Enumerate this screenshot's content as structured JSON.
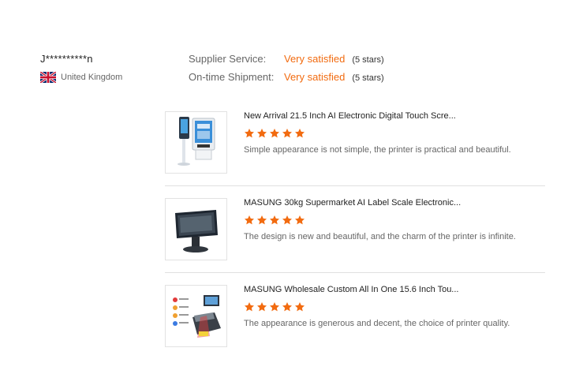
{
  "reviewer": {
    "name": "J**********n",
    "country": "United Kingdom",
    "flag_icon": "uk-flag-icon"
  },
  "ratings": [
    {
      "label": "Supplier Service:",
      "value": "Very satisfied",
      "stars_text": "(5 stars)"
    },
    {
      "label": "On-time Shipment:",
      "value": "Very satisfied",
      "stars_text": "(5 stars)"
    }
  ],
  "colors": {
    "accent": "#f26b10",
    "star": "#f26b10"
  },
  "products": [
    {
      "title": "New Arrival 21.5 Inch AI Electronic Digital Touch Scre...",
      "stars": 5,
      "comment": "Simple appearance is not simple, the printer is practical and beautiful.",
      "thumb_icon": "kiosk-product-image"
    },
    {
      "title": "MASUNG 30kg Supermarket AI Label Scale Electronic...",
      "stars": 5,
      "comment": "The design is new and beautiful, and the charm of the printer is infinite.",
      "thumb_icon": "pos-terminal-product-image"
    },
    {
      "title": "MASUNG Wholesale Custom All In One 15.6 Inch Tou...",
      "stars": 5,
      "comment": "The appearance is generous and decent, the choice of printer quality.",
      "thumb_icon": "scale-pos-product-image"
    }
  ]
}
